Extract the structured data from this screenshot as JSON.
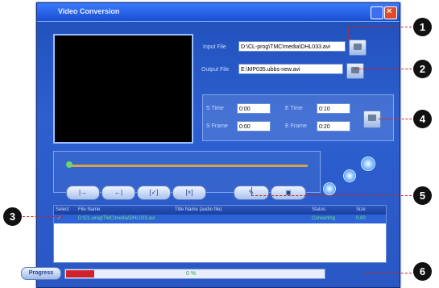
{
  "window": {
    "title": "Video Conversion"
  },
  "inputs": {
    "input_label": "Input File",
    "input_value": "D:\\CL-prog\\TMC\\media\\DHL033.avi",
    "output_label": "Output File",
    "output_value": "E:\\MP035.ubbs-new.avi"
  },
  "times": {
    "s_time_label": "S Time",
    "s_time_value": "0:00",
    "e_time_label": "E Time",
    "e_time_value": "0:10",
    "s_frame_label": "S Frame",
    "s_frame_value": "0:00",
    "e_frame_label": "E Frame",
    "e_frame_value": "0:20"
  },
  "controls": [
    "|→",
    "←|",
    "[✓]",
    "[×]"
  ],
  "tool_button": "▣",
  "grid": {
    "headers": [
      "Select",
      "File Name",
      "Title Name (audio file)",
      "Status",
      "Size"
    ],
    "row": [
      "✓",
      "D:\\CL-prog\\TMC\\media\\DHL033.avi",
      "",
      "Converting",
      "0.00"
    ]
  },
  "progress": {
    "button_label": "Progress",
    "percent_text": "0 %",
    "fraction": 0.11
  },
  "callouts": [
    "1",
    "2",
    "3",
    "4",
    "5",
    "6"
  ],
  "icons": [
    "browse-input-icon",
    "browse-output-icon",
    "settings-icon",
    "convert-icon"
  ]
}
